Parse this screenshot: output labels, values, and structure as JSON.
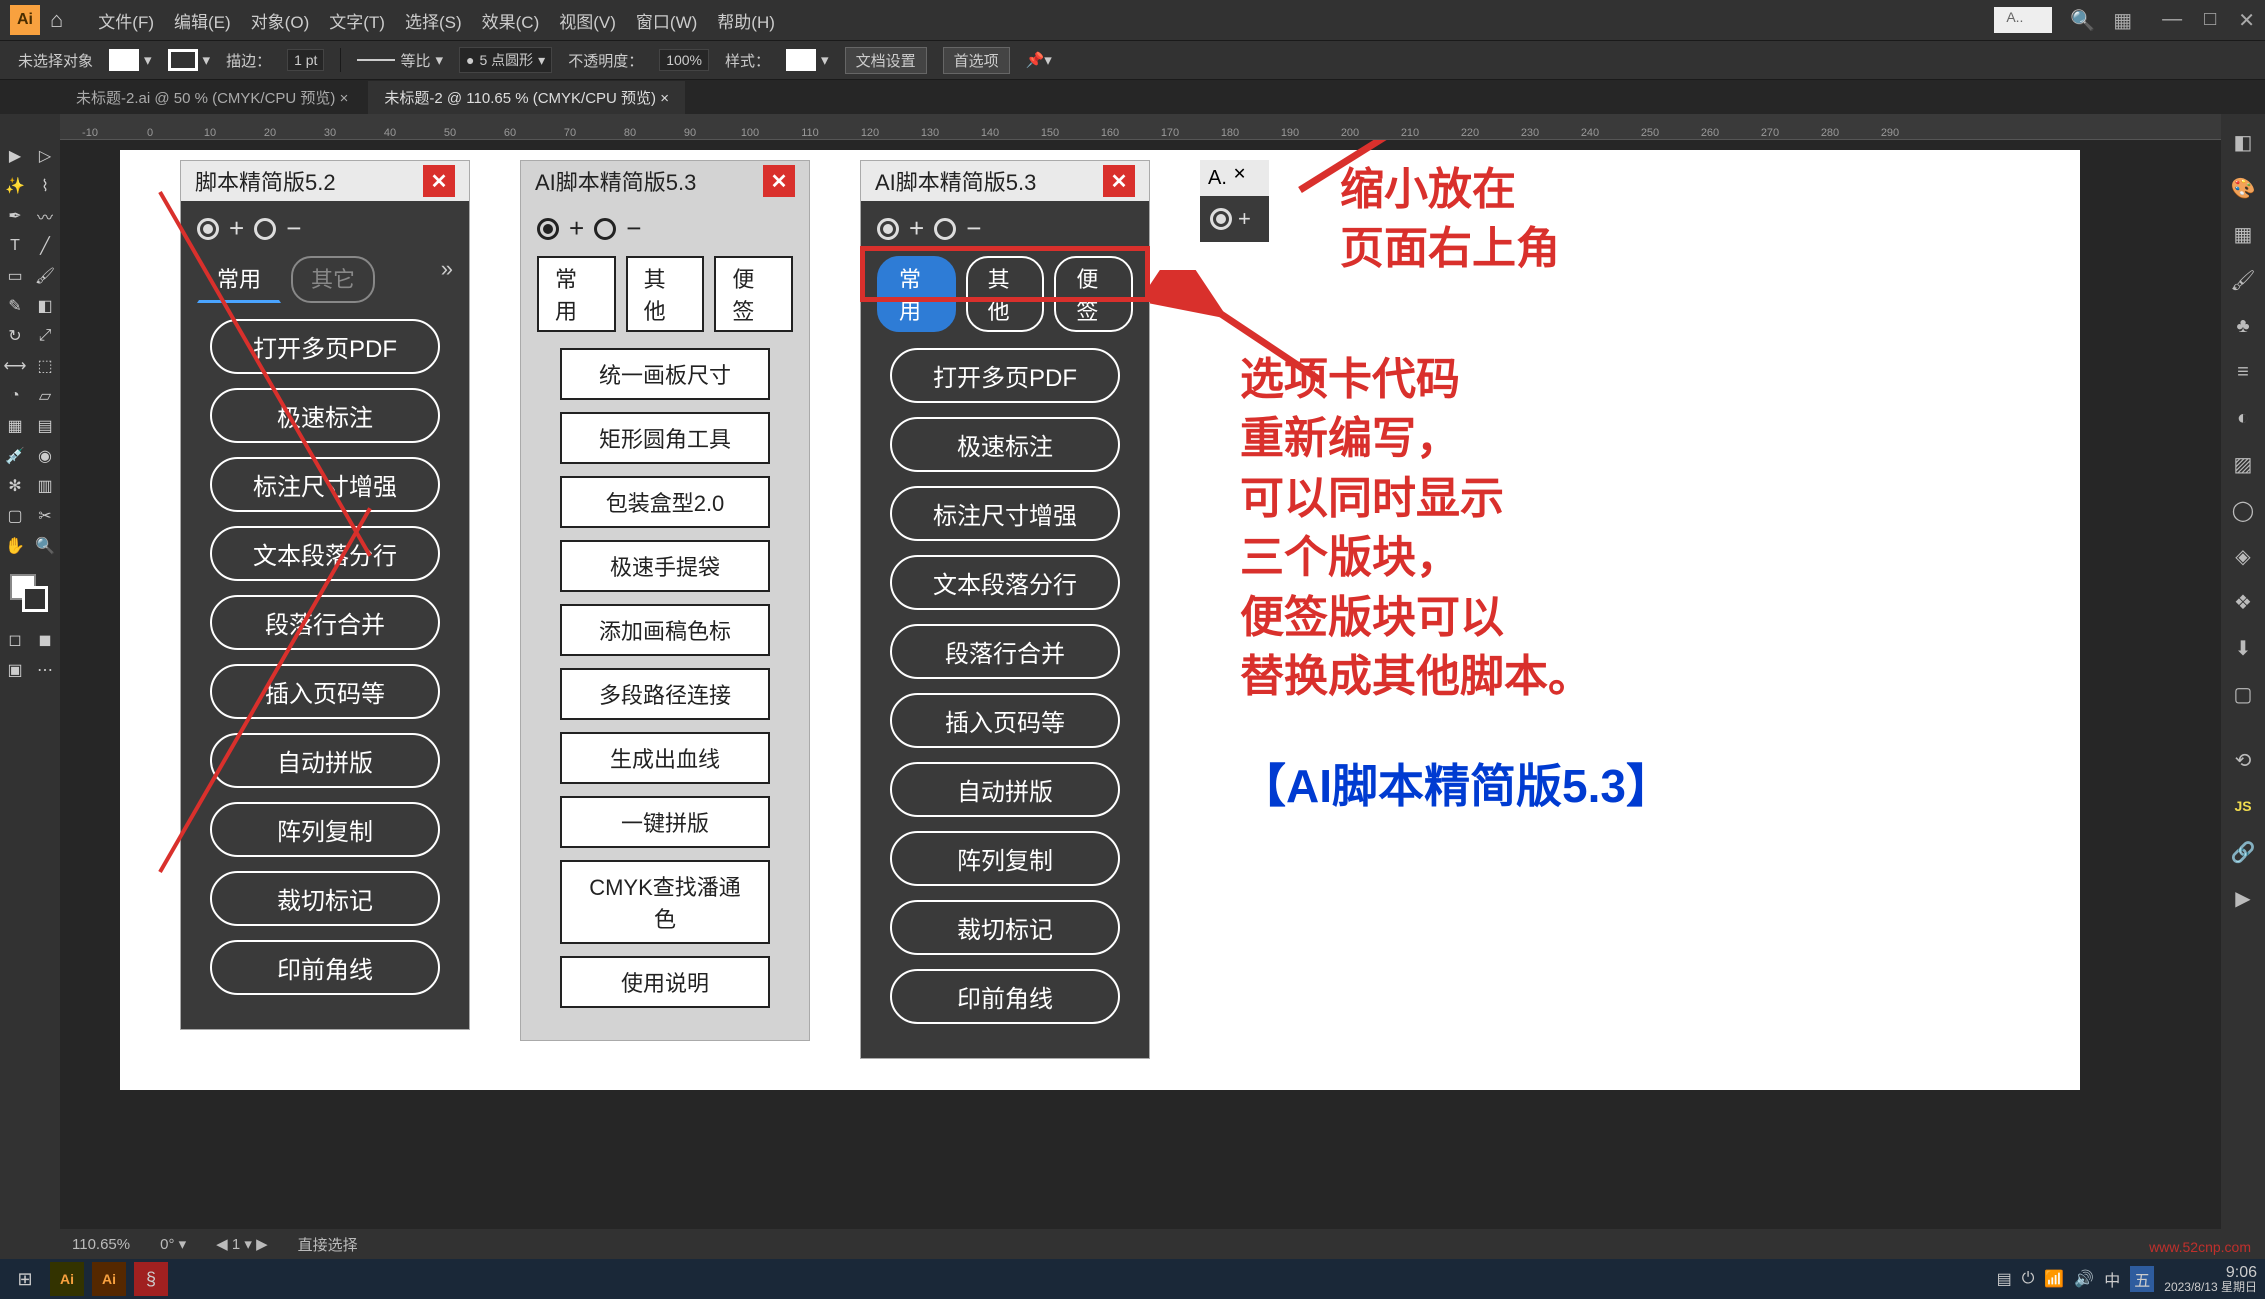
{
  "app": {
    "logo": "Ai"
  },
  "menus": [
    "文件(F)",
    "编辑(E)",
    "对象(O)",
    "文字(T)",
    "选择(S)",
    "效果(C)",
    "视图(V)",
    "窗口(W)",
    "帮助(H)"
  ],
  "topbox_placeholder": "A..",
  "options": {
    "noSelection": "未选择对象",
    "stroke": "描边：",
    "strokeVal": "1 pt",
    "uniform": "等比",
    "profile": "5 点圆形",
    "opacity": "不透明度：",
    "opacityVal": "100%",
    "style": "样式：",
    "docSetup": "文档设置",
    "prefs": "首选项"
  },
  "tabs": [
    {
      "label": "未标题-2.ai @ 50 % (CMYK/CPU 预览)",
      "active": false
    },
    {
      "label": "未标题-2 @ 110.65 % (CMYK/CPU 预览)",
      "active": true
    }
  ],
  "rulerTicks": [
    "-10",
    "0",
    "10",
    "20",
    "30",
    "40",
    "50",
    "60",
    "70",
    "80",
    "90",
    "100",
    "110",
    "120",
    "130",
    "140",
    "150",
    "160",
    "170",
    "180",
    "190",
    "200",
    "210",
    "220",
    "230",
    "240",
    "250",
    "260",
    "270",
    "280",
    "290"
  ],
  "panel52": {
    "title": "脚本精简版5.2",
    "tabs": [
      "常用",
      "其它"
    ],
    "items": [
      "打开多页PDF",
      "极速标注",
      "标注尺寸增强",
      "文本段落分行",
      "段落行合并",
      "插入页码等",
      "自动拼版",
      "阵列复制",
      "裁切标记",
      "印前角线"
    ]
  },
  "panel53light": {
    "title": "AI脚本精简版5.3",
    "tabs": [
      "常用",
      "其他",
      "便签"
    ],
    "items": [
      "统一画板尺寸",
      "矩形圆角工具",
      "包装盒型2.0",
      "极速手提袋",
      "添加画稿色标",
      "多段路径连接",
      "生成出血线",
      "一键拼版",
      "CMYK查找潘通色",
      "使用说明"
    ]
  },
  "panel53dark": {
    "title": "AI脚本精简版5.3",
    "tabs": [
      "常用",
      "其他",
      "便签"
    ],
    "items": [
      "打开多页PDF",
      "极速标注",
      "标注尺寸增强",
      "文本段落分行",
      "段落行合并",
      "插入页码等",
      "自动拼版",
      "阵列复制",
      "裁切标记",
      "印前角线"
    ]
  },
  "minipanel": {
    "title": "A."
  },
  "annotation": {
    "l1": "缩小放在\n页面右上角",
    "l2": "选项卡代码\n重新编写，\n可以同时显示\n三个版块，\n便签版块可以\n替换成其他脚本。",
    "footer": "【AI脚本精简版5.3】"
  },
  "status": {
    "zoom": "110.65%",
    "tool": "直接选择"
  },
  "taskbar": {
    "time": "9:06",
    "date": "2023/8/13 星期日"
  },
  "watermark": "www.52cnp.com"
}
